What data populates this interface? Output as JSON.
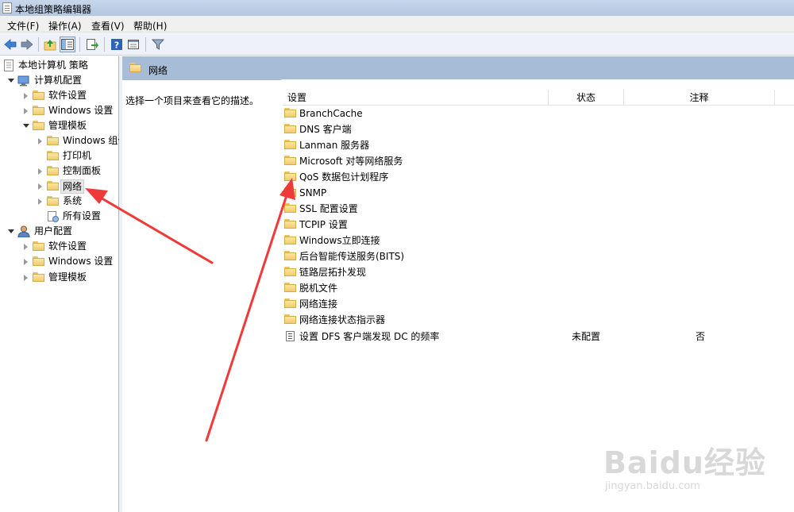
{
  "window": {
    "title": "本地组策略编辑器"
  },
  "menu": [
    {
      "label": "文件(F)"
    },
    {
      "label": "操作(A)"
    },
    {
      "label": "查看(V)"
    },
    {
      "label": "帮助(H)"
    }
  ],
  "tree": {
    "root": "本地计算机 策略",
    "computer_config": "计算机配置",
    "cc_software": "软件设置",
    "cc_windows": "Windows 设置",
    "cc_admin_templates": "管理模板",
    "at_windows_components": "Windows 组件",
    "at_printers": "打印机",
    "at_control_panel": "控制面板",
    "at_network": "网络",
    "at_system": "系统",
    "at_all_settings": "所有设置",
    "user_config": "用户配置",
    "uc_software": "软件设置",
    "uc_windows": "Windows 设置",
    "uc_admin_templates": "管理模板"
  },
  "right": {
    "header_title": "网络",
    "description": "选择一个项目来查看它的描述。",
    "columns": {
      "setting": "设置",
      "state": "状态",
      "comment": "注释"
    },
    "rows": [
      {
        "name": "BranchCache",
        "type": "folder",
        "state": "",
        "comment": ""
      },
      {
        "name": "DNS 客户端",
        "type": "folder",
        "state": "",
        "comment": ""
      },
      {
        "name": "Lanman 服务器",
        "type": "folder",
        "state": "",
        "comment": ""
      },
      {
        "name": "Microsoft 对等网络服务",
        "type": "folder",
        "state": "",
        "comment": ""
      },
      {
        "name": "QoS 数据包计划程序",
        "type": "folder",
        "state": "",
        "comment": ""
      },
      {
        "name": "SNMP",
        "type": "folder",
        "state": "",
        "comment": ""
      },
      {
        "name": "SSL 配置设置",
        "type": "folder",
        "state": "",
        "comment": ""
      },
      {
        "name": "TCPIP 设置",
        "type": "folder",
        "state": "",
        "comment": ""
      },
      {
        "name": "Windows立即连接",
        "type": "folder",
        "state": "",
        "comment": ""
      },
      {
        "name": "后台智能传送服务(BITS)",
        "type": "folder",
        "state": "",
        "comment": ""
      },
      {
        "name": "链路层拓扑发现",
        "type": "folder",
        "state": "",
        "comment": ""
      },
      {
        "name": "脱机文件",
        "type": "folder",
        "state": "",
        "comment": ""
      },
      {
        "name": "网络连接",
        "type": "folder",
        "state": "",
        "comment": ""
      },
      {
        "name": "网络连接状态指示器",
        "type": "folder",
        "state": "",
        "comment": ""
      },
      {
        "name": "设置 DFS 客户端发现 DC 的频率",
        "type": "setting",
        "state": "未配置",
        "comment": "否"
      }
    ]
  },
  "watermark": {
    "logo": "Baidu经验",
    "url": "jingyan.baidu.com"
  },
  "colors": {
    "header_blue": "#a7bcd6",
    "annotation_arrow": "#f03a3a",
    "folder": "#f2d27a"
  }
}
